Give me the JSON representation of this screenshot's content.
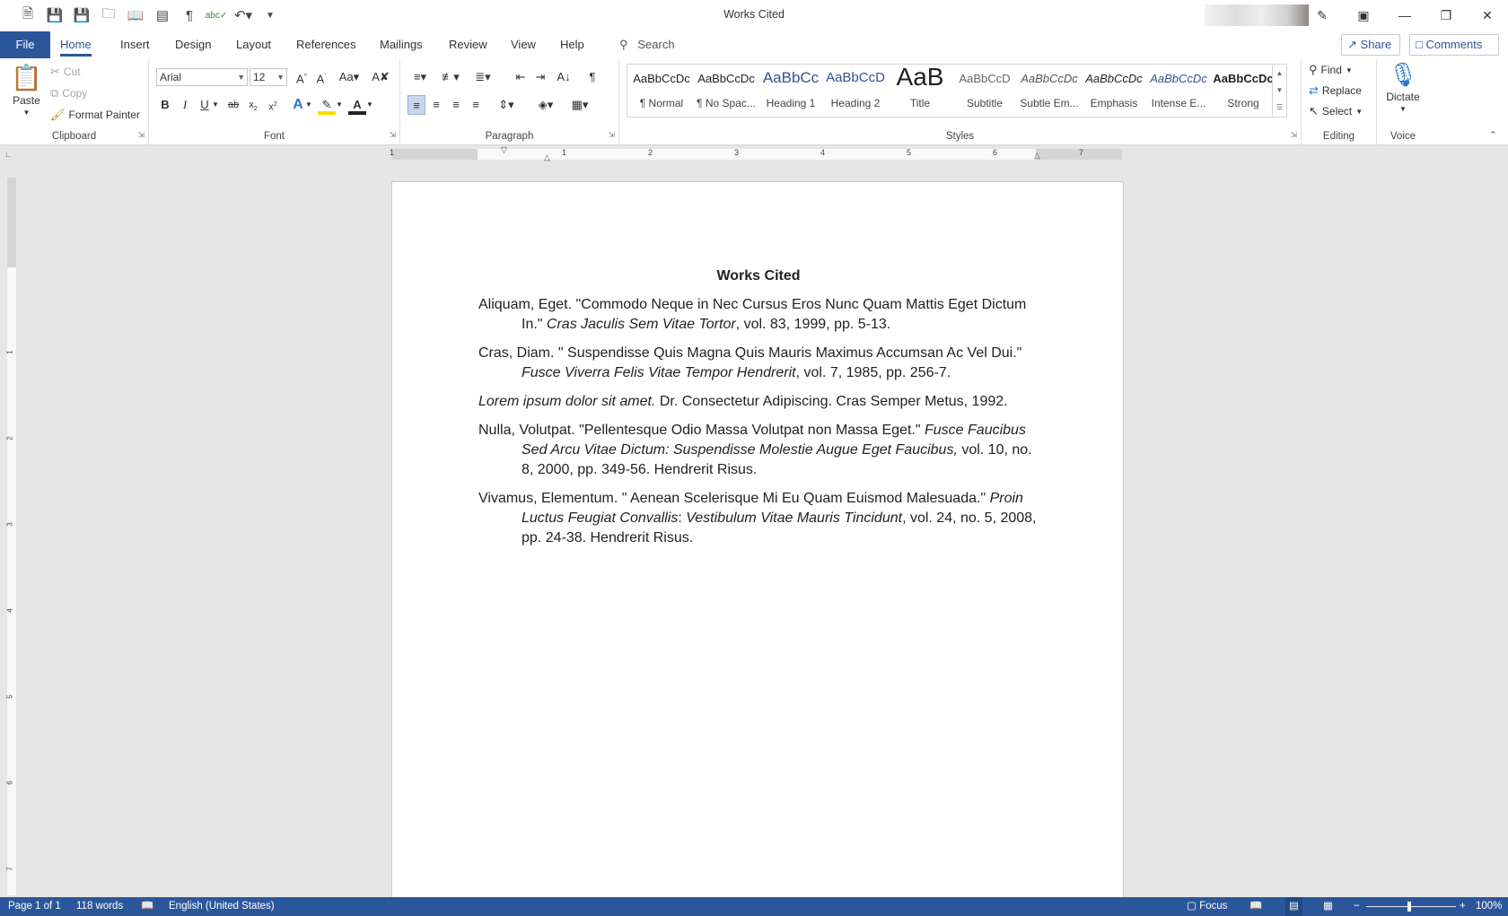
{
  "window": {
    "title": "Works Cited"
  },
  "qat": {
    "icons": [
      "new-document-icon",
      "save-icon",
      "save-as-icon",
      "open-icon",
      "print-layout-icon",
      "table-icon",
      "pilcrow-icon",
      "spelling-icon",
      "undo-icon",
      "customize-qat-icon"
    ]
  },
  "tabs": [
    "File",
    "Home",
    "Insert",
    "Design",
    "Layout",
    "References",
    "Mailings",
    "Review",
    "View",
    "Help"
  ],
  "search": {
    "label": "Search"
  },
  "share": {
    "label": "Share"
  },
  "comments": {
    "label": "Comments"
  },
  "clipboard": {
    "label": "Clipboard",
    "paste": "Paste",
    "cut": "Cut",
    "copy": "Copy",
    "format_painter": "Format Painter"
  },
  "font": {
    "label": "Font",
    "family": "Arial",
    "size": "12"
  },
  "paragraph": {
    "label": "Paragraph"
  },
  "styles": {
    "label": "Styles",
    "items": [
      {
        "preview": "AaBbCcDc",
        "name": "¶ Normal"
      },
      {
        "preview": "AaBbCcDc",
        "name": "¶ No Spac..."
      },
      {
        "preview": "AaBbCc",
        "name": "Heading 1"
      },
      {
        "preview": "AaBbCcD",
        "name": "Heading 2"
      },
      {
        "preview": "AaB",
        "name": "Title"
      },
      {
        "preview": "AaBbCcD",
        "name": "Subtitle"
      },
      {
        "preview": "AaBbCcDc",
        "name": "Subtle Em..."
      },
      {
        "preview": "AaBbCcDc",
        "name": "Emphasis"
      },
      {
        "preview": "AaBbCcDc",
        "name": "Intense E..."
      },
      {
        "preview": "AaBbCcDc",
        "name": "Strong"
      }
    ]
  },
  "editing": {
    "label": "Editing",
    "find": "Find",
    "replace": "Replace",
    "select": "Select"
  },
  "voice": {
    "label": "Voice",
    "dictate": "Dictate"
  },
  "ruler": {
    "numbers": [
      "1",
      "1",
      "2",
      "3",
      "4",
      "5",
      "6",
      "7"
    ]
  },
  "vruler": {
    "numbers": [
      "1",
      "2",
      "3",
      "4",
      "5",
      "6",
      "7"
    ]
  },
  "document": {
    "title": "Works Cited",
    "entries": [
      {
        "a": "Aliquam, Eget. \"Commodo Neque in Nec Cursus Eros Nunc Quam Mattis Eget Dictum In.\" ",
        "b": "Cras Jaculis Sem Vitae Tortor",
        "c": ", vol. 83, 1999, pp. 5-13."
      },
      {
        "a": "Cras, Diam. \" Suspendisse Quis Magna Quis Mauris Maximus Accumsan Ac Vel Dui.\" ",
        "b": "Fusce Viverra Felis Vitae Tempor Hendrerit",
        "c": ", vol. 7, 1985, pp. 256-7."
      },
      {
        "a": "",
        "b": "Lorem ipsum dolor sit amet.",
        "c": " Dr. Consectetur Adipiscing. Cras Semper Metus, 1992."
      },
      {
        "a": "Nulla, Volutpat. \"Pellentesque Odio Massa Volutpat non Massa Eget.\" ",
        "b": "Fusce Faucibus Sed Arcu Vitae Dictum: Suspendisse Molestie Augue Eget Faucibus,",
        "c": " vol. 10, no. 8, 2000, pp. 349-56. Hendrerit Risus."
      },
      {
        "a": "Vivamus, Elementum. \" Aenean Scelerisque Mi Eu Quam Euismod Malesuada.\" ",
        "b": "Proin Luctus Feugiat Convallis",
        "c": ": ",
        "d": "Vestibulum Vitae Mauris Tincidunt",
        "e": ", vol. 24, no. 5, 2008, pp. 24-38. Hendrerit Risus."
      }
    ]
  },
  "status": {
    "page": "Page 1 of 1",
    "words": "118 words",
    "language": "English (United States)",
    "focus": "Focus",
    "zoom": "100%",
    "zoom_minus": "−",
    "zoom_plus": "+"
  }
}
